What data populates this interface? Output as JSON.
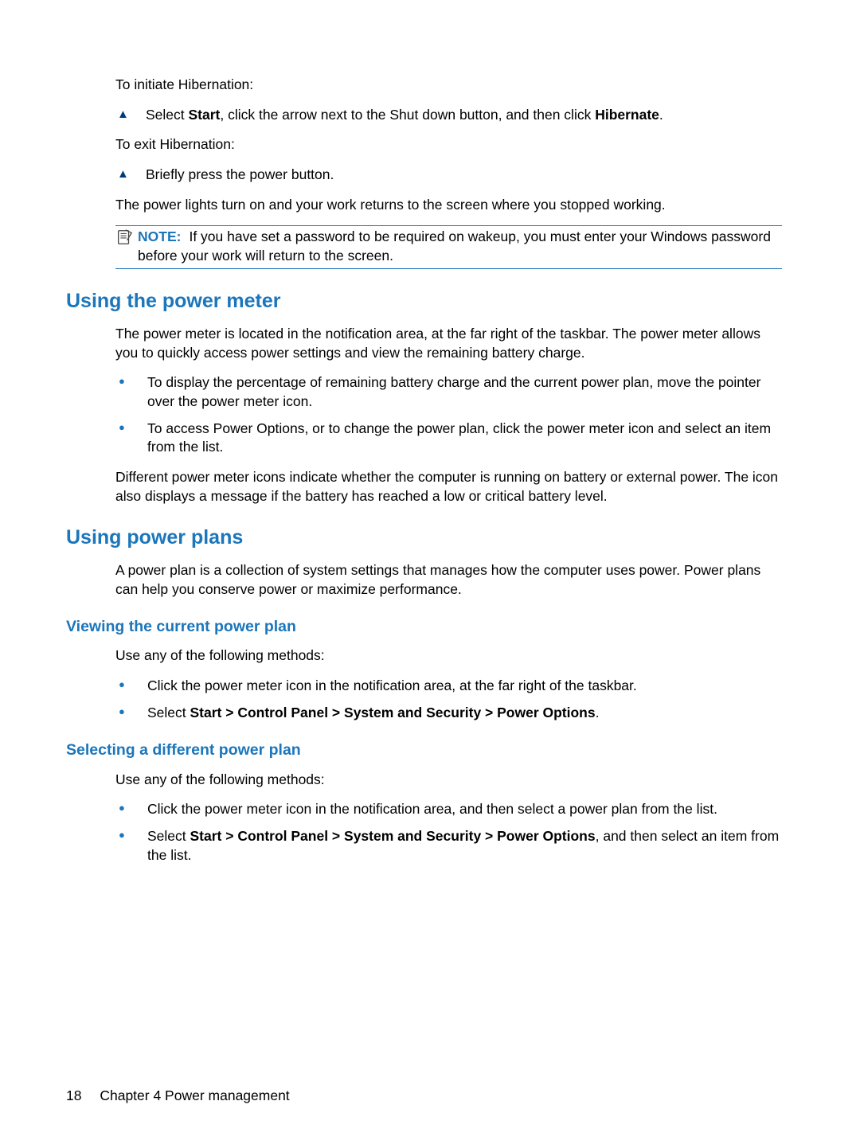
{
  "intro": {
    "initiate_label": "To initiate Hibernation:",
    "initiate_step_pre": "Select ",
    "initiate_step_b1": "Start",
    "initiate_step_mid": ", click the arrow next to the Shut down button, and then click ",
    "initiate_step_b2": "Hibernate",
    "initiate_step_post": ".",
    "exit_label": "To exit Hibernation:",
    "exit_step": "Briefly press the power button.",
    "resume_text": "The power lights turn on and your work returns to the screen where you stopped working.",
    "note_label": "NOTE:",
    "note_text": "If you have set a password to be required on wakeup, you must enter your Windows password before your work will return to the screen."
  },
  "power_meter": {
    "title": "Using the power meter",
    "p1": "The power meter is located in the notification area, at the far right of the taskbar. The power meter allows you to quickly access power settings and view the remaining battery charge.",
    "b1": "To display the percentage of remaining battery charge and the current power plan, move the pointer over the power meter icon.",
    "b2": "To access Power Options, or to change the power plan, click the power meter icon and select an item from the list.",
    "p2": "Different power meter icons indicate whether the computer is running on battery or external power. The icon also displays a message if the battery has reached a low or critical battery level."
  },
  "power_plans": {
    "title": "Using power plans",
    "p1": "A power plan is a collection of system settings that manages how the computer uses power. Power plans can help you conserve power or maximize performance."
  },
  "viewing": {
    "title": "Viewing the current power plan",
    "p1": "Use any of the following methods:",
    "b1": "Click the power meter icon in the notification area, at the far right of the taskbar.",
    "b2_pre": "Select ",
    "b2_bold": "Start > Control Panel > System and Security > Power Options",
    "b2_post": "."
  },
  "selecting": {
    "title": "Selecting a different power plan",
    "p1": "Use any of the following methods:",
    "b1": "Click the power meter icon in the notification area, and then select a power plan from the list.",
    "b2_pre": "Select ",
    "b2_bold": "Start > Control Panel > System and Security > Power Options",
    "b2_post": ", and then select an item from the list."
  },
  "footer": {
    "page": "18",
    "chapter": "Chapter 4   Power management"
  }
}
